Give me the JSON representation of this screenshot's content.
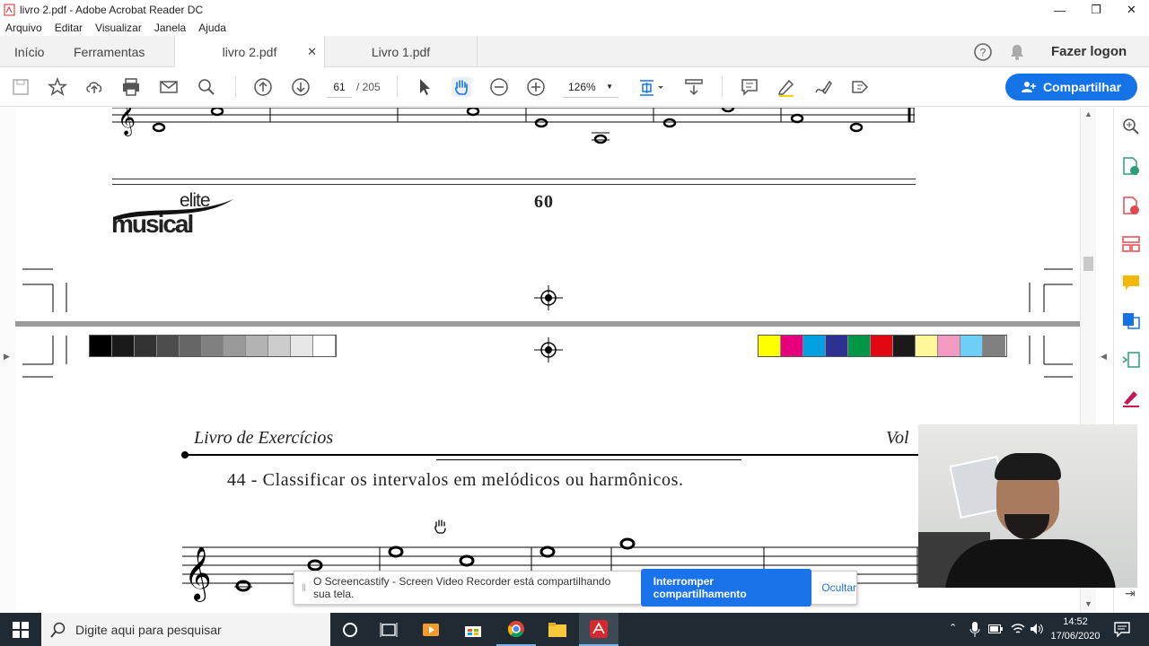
{
  "window": {
    "title": "livro 2.pdf - Adobe Acrobat Reader DC"
  },
  "menu": [
    "Arquivo",
    "Editar",
    "Visualizar",
    "Janela",
    "Ajuda"
  ],
  "tabs": {
    "home": "Início",
    "tools": "Ferramentas",
    "doc1": "livro 2.pdf",
    "doc2": "Livro 1.pdf"
  },
  "header": {
    "login": "Fazer logon",
    "share": "Compartilhar"
  },
  "toolbar": {
    "page_current": "61",
    "page_total": "/ 205",
    "zoom": "126%"
  },
  "page": {
    "page_number": "60",
    "logo_top": "elite",
    "logo_bottom": "musical",
    "book_title": "Livro de Exercícios",
    "volume_partial": "Vol",
    "exercise": "44 - Classificar os intervalos em melódicos ou harmônicos."
  },
  "color_bar": {
    "grays": [
      "#000000",
      "#1a1a1a",
      "#333333",
      "#4d4d4d",
      "#666666",
      "#808080",
      "#999999",
      "#b3b3b3",
      "#cccccc",
      "#e6e6e6",
      "#ffffff"
    ],
    "colors": [
      "#ffff00",
      "#e6007e",
      "#00a0e3",
      "#2e3192",
      "#009846",
      "#e30613",
      "#1a1a1a",
      "#fff799",
      "#f49ac1",
      "#6dcff6",
      "#808080"
    ]
  },
  "notification": {
    "text": "O Screencastify - Screen Video Recorder está compartilhando sua tela.",
    "stop": "Interromper compartilhamento",
    "hide": "Ocultar"
  },
  "taskbar": {
    "search_placeholder": "Digite aqui para pesquisar",
    "time": "14:52",
    "date": "17/06/2020"
  },
  "colors": {
    "accent": "#1473e6",
    "taskbar": "#1f2a33"
  }
}
